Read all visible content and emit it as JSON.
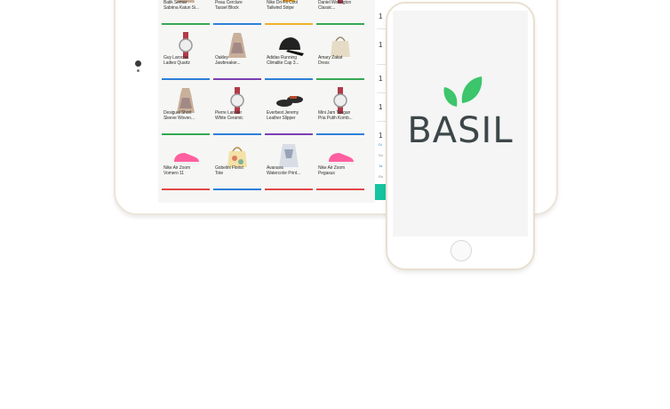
{
  "products": [
    {
      "name": "Batik Semar\nSabrina Katun Si...",
      "bar": "#35a853",
      "icon": "dress-icon"
    },
    {
      "name": "Peau Cerclure\nTassel Block",
      "bar": "#2d7fd8",
      "icon": "handbag-icon"
    },
    {
      "name": "Nike Dri-Fit Cool\nTailwind Stripe",
      "bar": "#f0b12a",
      "icon": "tshirt-icon"
    },
    {
      "name": "Daniel Wellington\nClassic...",
      "bar": "#35a853",
      "icon": "watch-icon"
    },
    {
      "name": "Guy Laroche\nLadies Quartz",
      "bar": "#2d7fd8",
      "icon": "watch-icon"
    },
    {
      "name": "Oakley\nJawbreaker...",
      "bar": "#7b3fb0",
      "icon": "dress-icon"
    },
    {
      "name": "Adidas Running\nClimalite Cap 3...",
      "bar": "#2d7fd8",
      "icon": "cap-icon"
    },
    {
      "name": "Amary Zakat\nDress",
      "bar": "#35a853",
      "icon": "bag-icon"
    },
    {
      "name": "Desigual Short\nSleeve Woven...",
      "bar": "#35a853",
      "icon": "dress-icon"
    },
    {
      "name": "Pierre Lannier\nWhite Ceramic",
      "bar": "#2d7fd8",
      "icon": "watch-icon"
    },
    {
      "name": "Everbest Jeremy\nLeather Slipper",
      "bar": "#7b3fb0",
      "icon": "slipper-icon"
    },
    {
      "name": "Mini Jam Tangan\nPria Putih Komb...",
      "bar": "#2d7fd8",
      "icon": "watch-icon"
    },
    {
      "name": "Nike Air Zoom\nVomero 11",
      "bar": "#e04848",
      "icon": "shoe-icon"
    },
    {
      "name": "Gobelini Florist\nTote",
      "bar": "#2d7fd8",
      "icon": "tote-icon"
    },
    {
      "name": "Avanava\nWatercolor Print...",
      "bar": "#e04848",
      "icon": "top-icon"
    },
    {
      "name": "Nike Air Zoom\nPegasus",
      "bar": "#e04848",
      "icon": "shoe-icon"
    }
  ],
  "cart": {
    "quantities": [
      "1",
      "1",
      "1",
      "1",
      "1"
    ],
    "summary_labels": [
      "Di",
      "Su",
      "Ta",
      "Ro"
    ]
  },
  "phone": {
    "logo_text": "BASIL",
    "logo_color": "#3d4749",
    "leaf_color": "#3cc56a"
  }
}
